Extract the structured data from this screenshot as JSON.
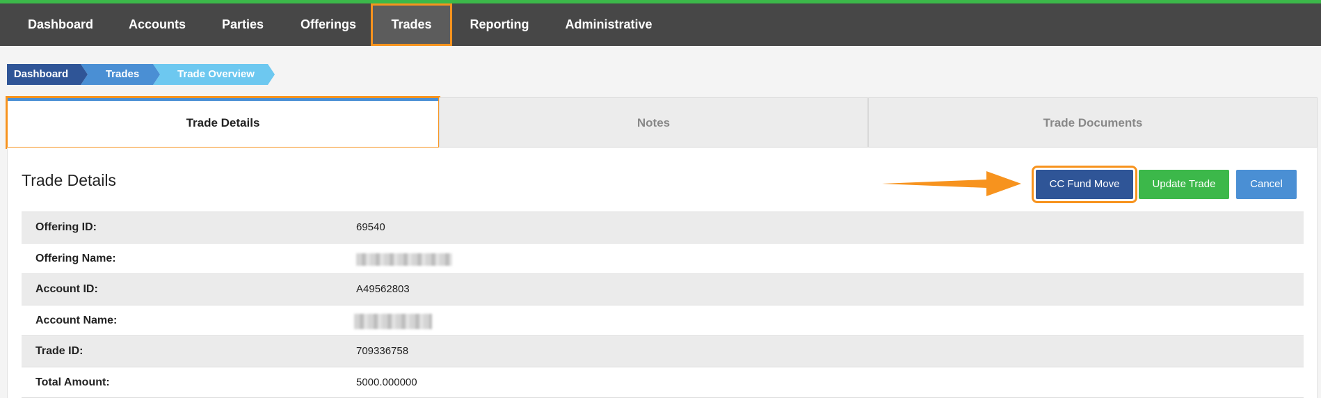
{
  "nav": {
    "items": [
      {
        "label": "Dashboard"
      },
      {
        "label": "Accounts"
      },
      {
        "label": "Parties"
      },
      {
        "label": "Offerings"
      },
      {
        "label": "Trades",
        "active": true
      },
      {
        "label": "Reporting"
      },
      {
        "label": "Administrative"
      }
    ]
  },
  "breadcrumb": [
    "Dashboard",
    "Trades",
    "Trade Overview"
  ],
  "tabs": [
    {
      "label": "Trade Details",
      "active": true
    },
    {
      "label": "Notes"
    },
    {
      "label": "Trade Documents"
    }
  ],
  "main": {
    "title": "Trade Details",
    "buttons": {
      "cc_fund_move": "CC Fund Move",
      "update_trade": "Update Trade",
      "cancel": "Cancel"
    },
    "details": [
      {
        "label": "Offering ID:",
        "value": "69540"
      },
      {
        "label": "Offering Name:",
        "value": ""
      },
      {
        "label": "Account ID:",
        "value": "A49562803"
      },
      {
        "label": "Account Name:",
        "value": ""
      },
      {
        "label": "Trade ID:",
        "value": "709336758"
      },
      {
        "label": "Total Amount:",
        "value": "5000.000000"
      }
    ]
  },
  "colors": {
    "accent_green": "#3cb84a",
    "highlight_orange": "#f7931e",
    "primary_blue": "#2f5597",
    "secondary_blue": "#4a8fd4",
    "light_blue": "#6dc8f0",
    "nav_bg": "#474747"
  }
}
